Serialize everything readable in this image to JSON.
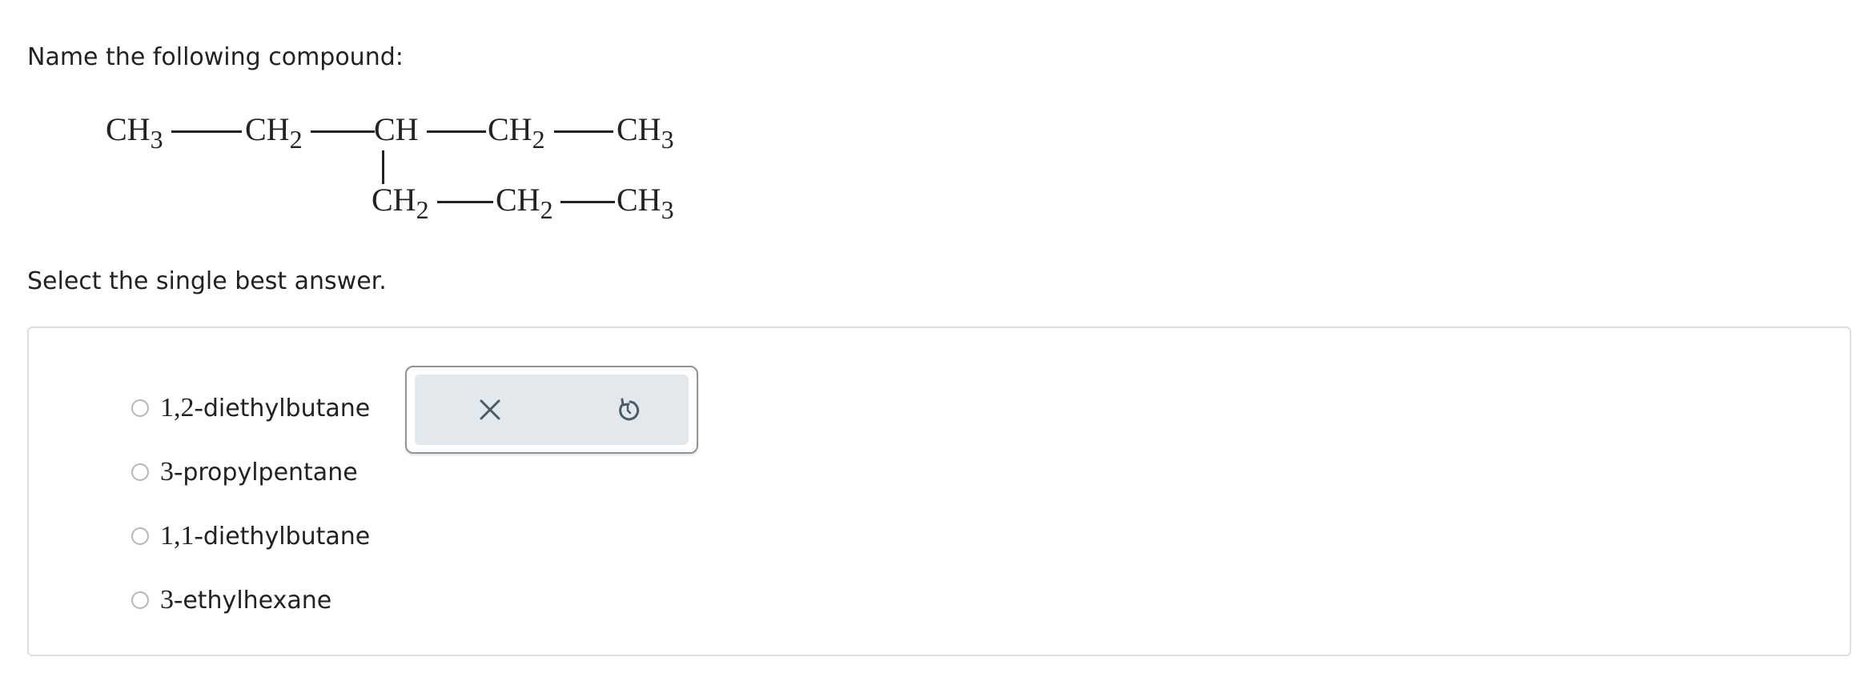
{
  "question": {
    "prompt": "Name the following compound:",
    "instruction": "Select the single best answer."
  },
  "structure": {
    "main_chain": [
      {
        "base": "CH",
        "sub": "3"
      },
      {
        "base": "CH",
        "sub": "2"
      },
      {
        "base": "CH",
        "sub": ""
      },
      {
        "base": "CH",
        "sub": "2"
      },
      {
        "base": "CH",
        "sub": "3"
      }
    ],
    "branch": [
      {
        "base": "CH",
        "sub": "2"
      },
      {
        "base": "CH",
        "sub": "2"
      },
      {
        "base": "CH",
        "sub": "3"
      }
    ]
  },
  "options": [
    {
      "prefix": "1,2-",
      "name": "diethylbutane"
    },
    {
      "prefix": "3-",
      "name": "propylpentane"
    },
    {
      "prefix": "1,1-",
      "name": "diethylbutane"
    },
    {
      "prefix": "3-",
      "name": "ethylhexane"
    }
  ],
  "tools": {
    "clear_icon": "close-icon",
    "undo_icon": "undo-icon",
    "icon_color": "#4a5d6b"
  },
  "colors": {
    "text": "#222222",
    "panel_border": "#dcdfe2",
    "tool_bg": "#e3e8ec",
    "radio_border": "#b3b8bd"
  }
}
